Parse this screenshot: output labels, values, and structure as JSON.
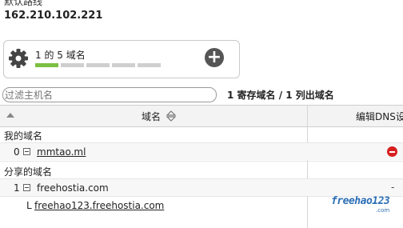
{
  "header": {
    "route_label": "默认路线",
    "ip": "162.210.102.221"
  },
  "domain_counter": {
    "label": "1 的 5 域名",
    "used": 1,
    "total": 5,
    "icon": "gear-icon",
    "add_icon": "plus-icon"
  },
  "filter": {
    "placeholder": "过滤主机名",
    "value": ""
  },
  "summary": "1 寄存域名 / 1 列出域名",
  "table": {
    "columns": [
      "域名",
      "编辑DNS设"
    ],
    "groups": [
      {
        "title": "我的域名",
        "rows": [
          {
            "index": "0",
            "domain": "mmtao.ml",
            "action": "delete-icon"
          }
        ]
      },
      {
        "title": "分享的域名",
        "rows": [
          {
            "index": "1",
            "domain": "freehostia.com",
            "action": "-",
            "children": [
              {
                "prefix": "L",
                "domain": "freehao123.freehostia.com"
              }
            ]
          }
        ]
      }
    ]
  },
  "watermark": {
    "text": "freehao123",
    "sub": ".com"
  },
  "colors": {
    "progress_on": "#7bc043",
    "progress_off": "#cfcfcf",
    "delete": "#d81e1e"
  }
}
